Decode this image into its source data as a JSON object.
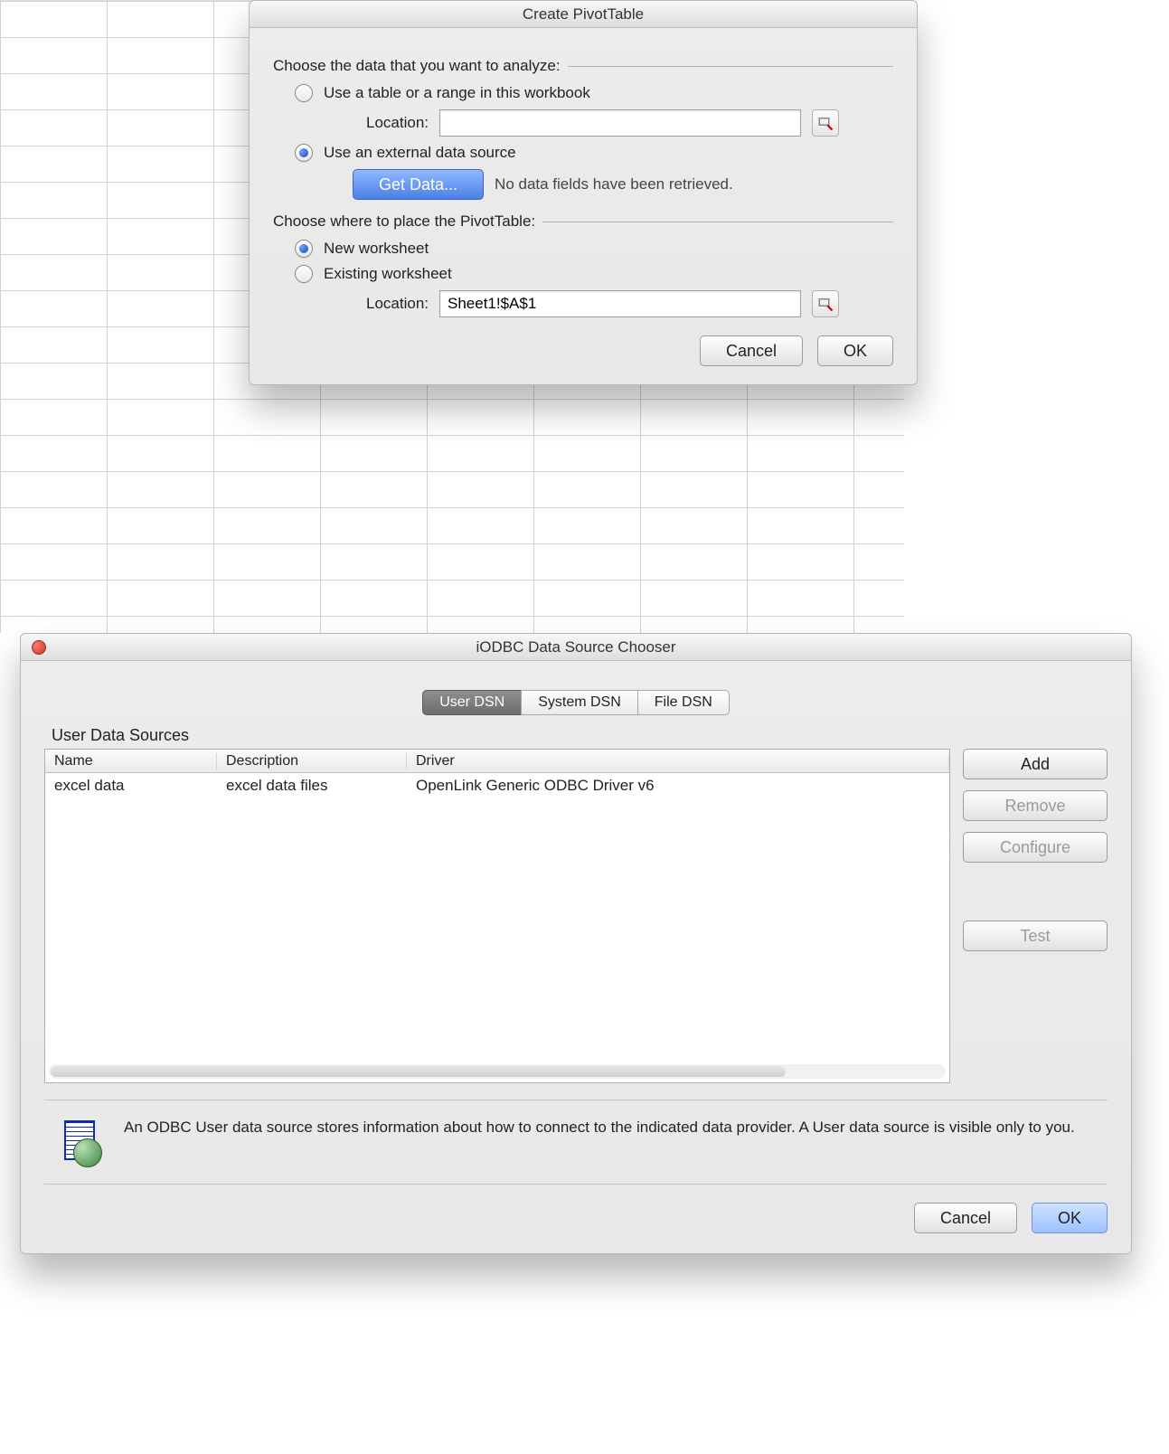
{
  "pivot": {
    "title": "Create PivotTable",
    "choose_data_label": "Choose the data that you want to analyze:",
    "opt_table_range": "Use a table or a range in this workbook",
    "location_label": "Location:",
    "location_value": "",
    "opt_external": "Use an external data source",
    "get_data_label": "Get Data...",
    "get_data_msg": "No data fields have been retrieved.",
    "choose_place_label": "Choose where to place the PivotTable:",
    "opt_new_ws": "New worksheet",
    "opt_existing_ws": "Existing worksheet",
    "place_location_value": "Sheet1!$A$1",
    "cancel": "Cancel",
    "ok": "OK"
  },
  "chooser": {
    "title": "iODBC Data Source Chooser",
    "tabs": {
      "user": "User DSN",
      "system": "System DSN",
      "file": "File DSN"
    },
    "section_caption": "User Data Sources",
    "columns": {
      "name": "Name",
      "description": "Description",
      "driver": "Driver"
    },
    "rows": [
      {
        "name": "excel data",
        "description": "excel data files",
        "driver": "OpenLink Generic ODBC Driver v6"
      }
    ],
    "side": {
      "add": "Add",
      "remove": "Remove",
      "configure": "Configure",
      "test": "Test"
    },
    "info": "An ODBC User data source stores information about how to connect to the indicated data provider. A User data source is visible only to you.",
    "cancel": "Cancel",
    "ok": "OK"
  }
}
